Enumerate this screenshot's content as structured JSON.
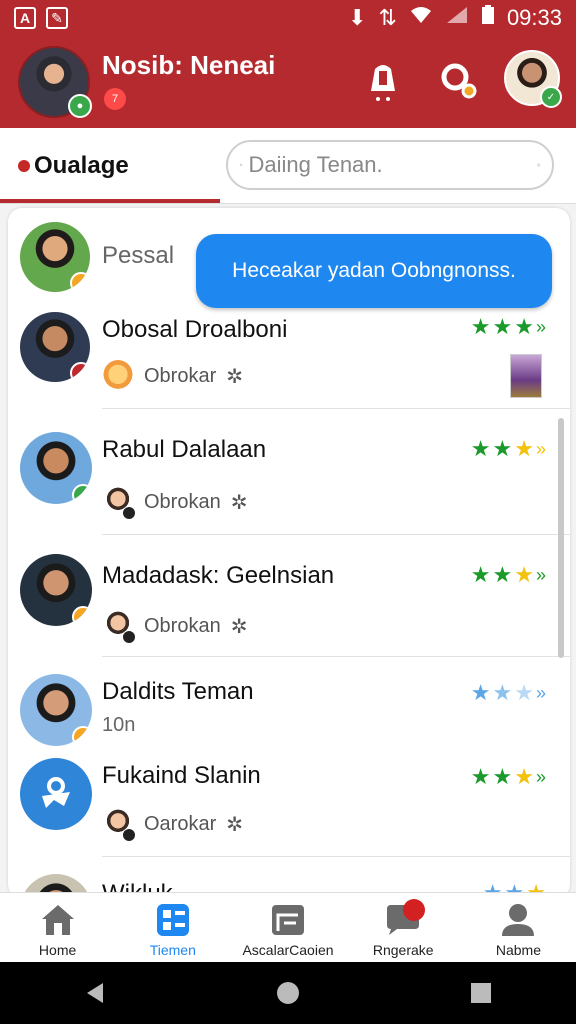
{
  "statusbar": {
    "time": "09:33"
  },
  "header": {
    "title": "Nosib: Neneai",
    "notification_count": "7"
  },
  "tabs": {
    "active_label": "Oualage"
  },
  "search": {
    "placeholder": "Daiing Tenan."
  },
  "bubble": {
    "text": "Heceakar yadan Oobngnonss."
  },
  "first_item": {
    "name": "Pessal"
  },
  "contacts": [
    {
      "name": "Obosal Droalboni",
      "sub": "Obrokar",
      "rating": 3
    },
    {
      "name": "Rabul Dalalaan",
      "sub": "Obrokan",
      "rating": 3
    },
    {
      "name": "Madadask: Geelnsian",
      "sub": "Obrokan",
      "rating": 3
    },
    {
      "name": "Daldits Teman",
      "sub": "10n",
      "rating": 3
    },
    {
      "name": "Fukaind Slanin",
      "sub": "Oarokar",
      "rating": 3
    }
  ],
  "partial_row": {
    "name": "Wikluk..."
  },
  "bottom_nav": [
    {
      "label": "Home",
      "icon": "home-icon"
    },
    {
      "label": "Tiemen",
      "icon": "grid-icon"
    },
    {
      "label": "AscalarCaoien",
      "icon": "store-icon"
    },
    {
      "label": "Rngerake",
      "icon": "chat-icon"
    },
    {
      "label": "Nabme",
      "icon": "profile-icon"
    }
  ],
  "colors": {
    "brand": "#b52a2f",
    "accent": "#1e88f0",
    "star_green": "#1a9a2a",
    "star_yellow": "#f2c20c",
    "star_blue": "#5aa6e8"
  }
}
